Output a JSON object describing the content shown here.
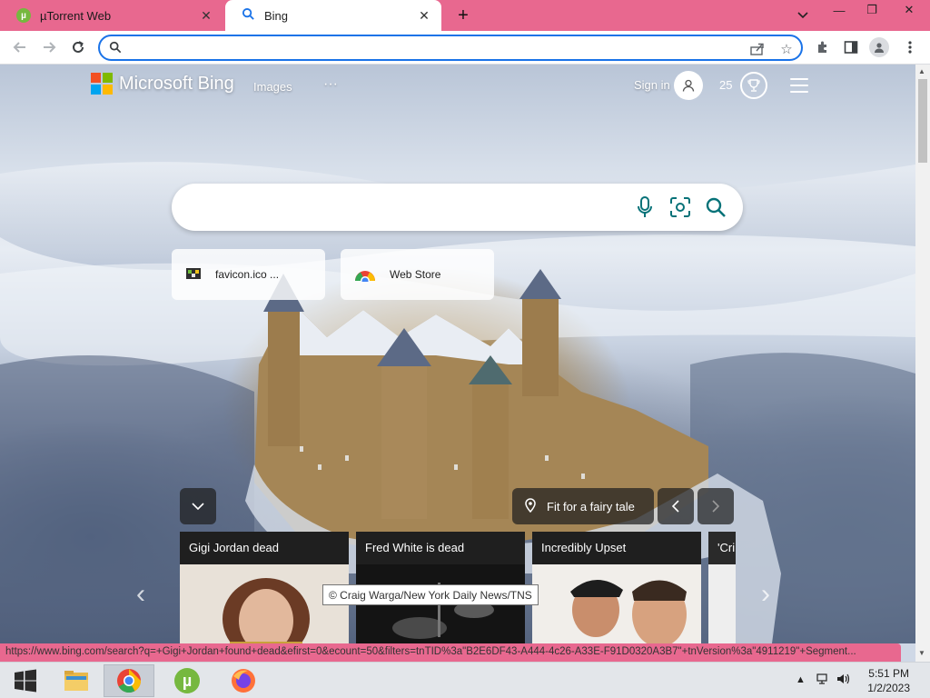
{
  "browser": {
    "tabs": [
      {
        "title": "µTorrent Web",
        "close": "✕"
      },
      {
        "title": "Bing",
        "close": "✕"
      }
    ],
    "new_tab": "+",
    "window_controls": {
      "dropdown": "⌄",
      "minimize": "—",
      "restore": "❐",
      "close": "✕"
    },
    "address_value": "",
    "status_url": "https://www.bing.com/search?q=+Gigi+Jordan+found+dead&efirst=0&ecount=50&filters=tnTID%3a\"B2E6DF43-A444-4c26-A33E-F91D0320A3B7\"+tnVersion%3a\"4911219\"+Segment..."
  },
  "bing": {
    "brand": "Microsoft Bing",
    "nav": {
      "images": "Images",
      "more": "···"
    },
    "sign_in": "Sign in",
    "rewards_points": "25",
    "search_value": "",
    "quick_links": [
      {
        "label": "favicon.ico ..."
      },
      {
        "label": "Web Store"
      }
    ],
    "image_caption": "Fit for a fairy tale",
    "image_credit": "© Craig Warga/New York Daily News/TNS",
    "news": [
      {
        "title": "Gigi Jordan dead"
      },
      {
        "title": "Fred White is dead"
      },
      {
        "title": "Incredibly Upset"
      },
      {
        "title": "'Cri"
      }
    ]
  },
  "taskbar": {
    "time": "5:51 PM",
    "date": "1/2/2023"
  },
  "colors": {
    "tab_strip": "#e8688f",
    "accent_blue": "#1a73e8",
    "bing_teal": "#067278",
    "ms_red": "#f25022",
    "ms_green": "#7fba00",
    "ms_blue": "#00a4ef",
    "ms_yellow": "#ffb900"
  }
}
